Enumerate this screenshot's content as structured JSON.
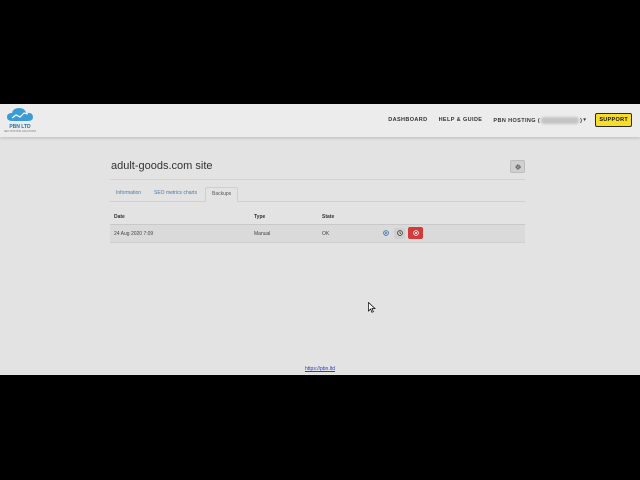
{
  "brand": {
    "name": "PBN LTD",
    "tagline": "SEO HOSTING SOLUTIONS"
  },
  "nav": {
    "dashboard": "DASHBOARD",
    "help": "HELP & GUIDE",
    "hosting_prefix": "PBN HOSTING (",
    "hosting_suffix": ")",
    "support": "SUPPORT"
  },
  "page": {
    "title": "adult-goods.com site"
  },
  "tabs": [
    {
      "label": "Information",
      "active": false
    },
    {
      "label": "SEO metrics charts",
      "active": false
    },
    {
      "label": "Backups",
      "active": true
    }
  ],
  "table": {
    "headers": {
      "date": "Date",
      "type": "Type",
      "state": "State"
    },
    "rows": [
      {
        "date": "24 Aug 2020 7:09",
        "type": "Manual",
        "state": "OK"
      }
    ]
  },
  "footer": {
    "link": "https://pbn.ltd"
  },
  "colors": {
    "accent_yellow": "#f5dd2a",
    "danger": "#d23b3b",
    "link": "#4a78a6",
    "brand_blue": "#2c8fd0"
  }
}
